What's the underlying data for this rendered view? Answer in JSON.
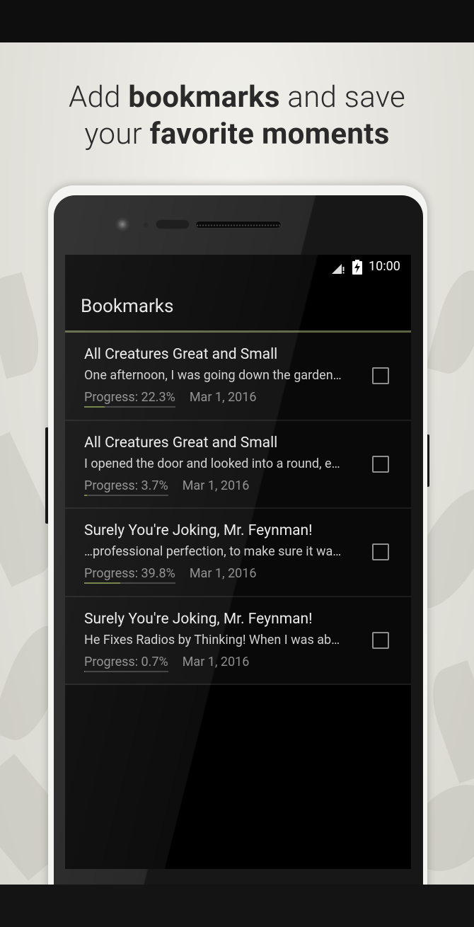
{
  "headline": {
    "line1_pre": "Add ",
    "line1_bold": "bookmarks",
    "line1_post": " and save",
    "line2_pre": "your ",
    "line2_bold": "favorite moments"
  },
  "status_bar": {
    "time": "10:00",
    "signal_icon": "signal-icon",
    "battery_icon": "battery-charging-icon"
  },
  "app_bar": {
    "title": "Bookmarks"
  },
  "bookmarks": [
    {
      "title": "All Creatures Great and Small",
      "snippet": "One afternoon, I was going down the garden…",
      "progress_label": "Progress: 22.3%",
      "progress": 0.223,
      "date": "Mar 1, 2016",
      "checked": false
    },
    {
      "title": "All Creatures Great and Small",
      "snippet": "I opened the door and looked into a round, e…",
      "progress_label": "Progress: 3.7%",
      "progress": 0.037,
      "date": "Mar 1, 2016",
      "checked": false
    },
    {
      "title": "Surely You're Joking, Mr. Feynman!",
      "snippet": "…professional perfection, to make sure it wa…",
      "progress_label": "Progress: 39.8%",
      "progress": 0.398,
      "date": "Mar 1, 2016",
      "checked": false
    },
    {
      "title": "Surely You're Joking, Mr. Feynman!",
      "snippet": "He Fixes Radios by Thinking! When I was ab…",
      "progress_label": "Progress: 0.7%",
      "progress": 0.007,
      "date": "Mar 1, 2016",
      "checked": false
    }
  ],
  "colors": {
    "accent": "#6b7b3c",
    "screen_bg": "#000000",
    "promo_bg": "#e6e5df"
  }
}
